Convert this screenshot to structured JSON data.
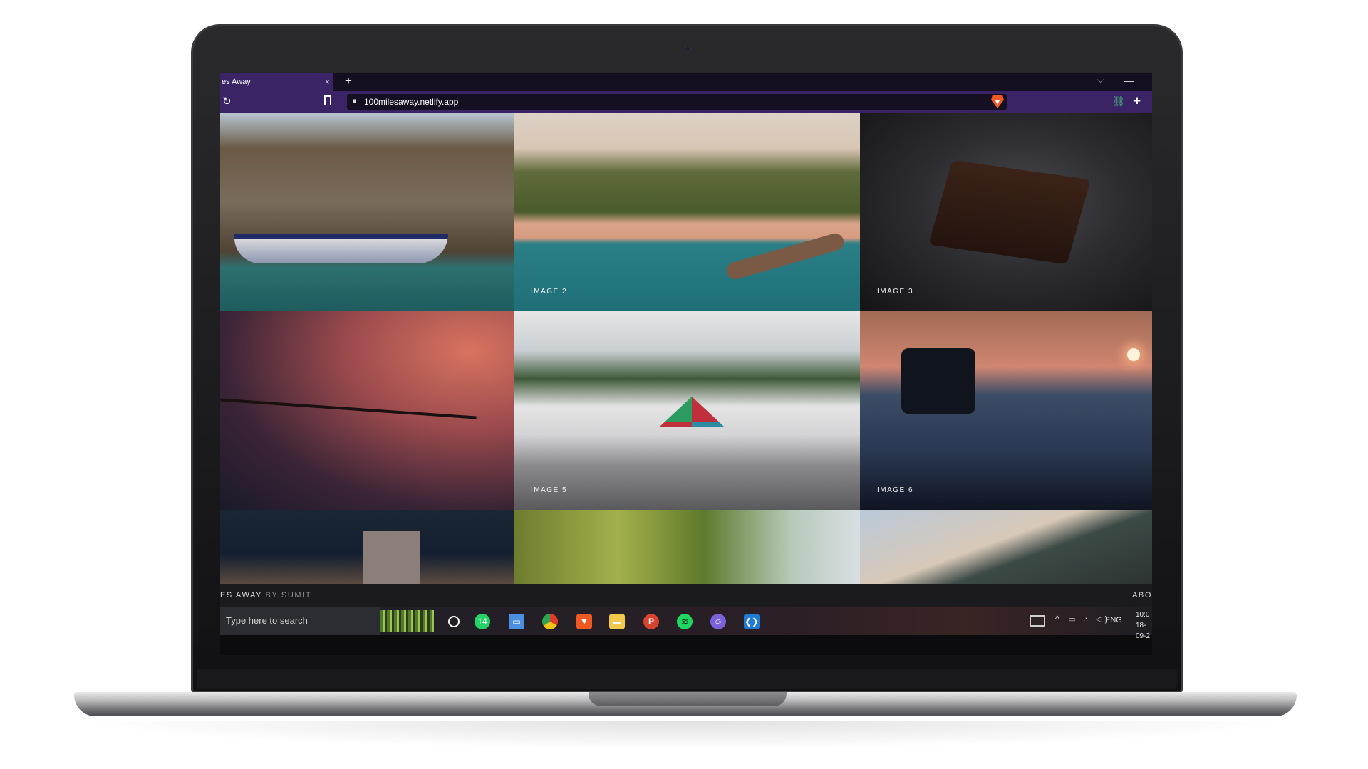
{
  "browser": {
    "tab_title": "es Away",
    "tab_close": "×",
    "new_tab": "+",
    "tab_list": "⌵",
    "minimize": "—",
    "reload_icon": "reload-icon",
    "url": "100milesaway.netlify.app",
    "brave_shield": "brave-shield-icon"
  },
  "gallery": {
    "images": [
      {
        "label": ""
      },
      {
        "label": "IMAGE 2"
      },
      {
        "label": "IMAGE 3"
      },
      {
        "label": ""
      },
      {
        "label": "IMAGE 5"
      },
      {
        "label": "IMAGE 6"
      },
      {
        "label": ""
      },
      {
        "label": ""
      },
      {
        "label": ""
      }
    ]
  },
  "site_footer": {
    "name": "ES AWAY",
    "by": "BY SUMIT",
    "nav_item": "ABO"
  },
  "taskbar": {
    "search_placeholder": "Type here to search",
    "whatsapp_badge": "14",
    "tray_lang": "ENG",
    "time": "10:0",
    "date": "18-09-2"
  },
  "colors": {
    "browser_accent": "#3a2466",
    "tab_strip": "#150f22",
    "brave_orange": "#f05a22"
  }
}
